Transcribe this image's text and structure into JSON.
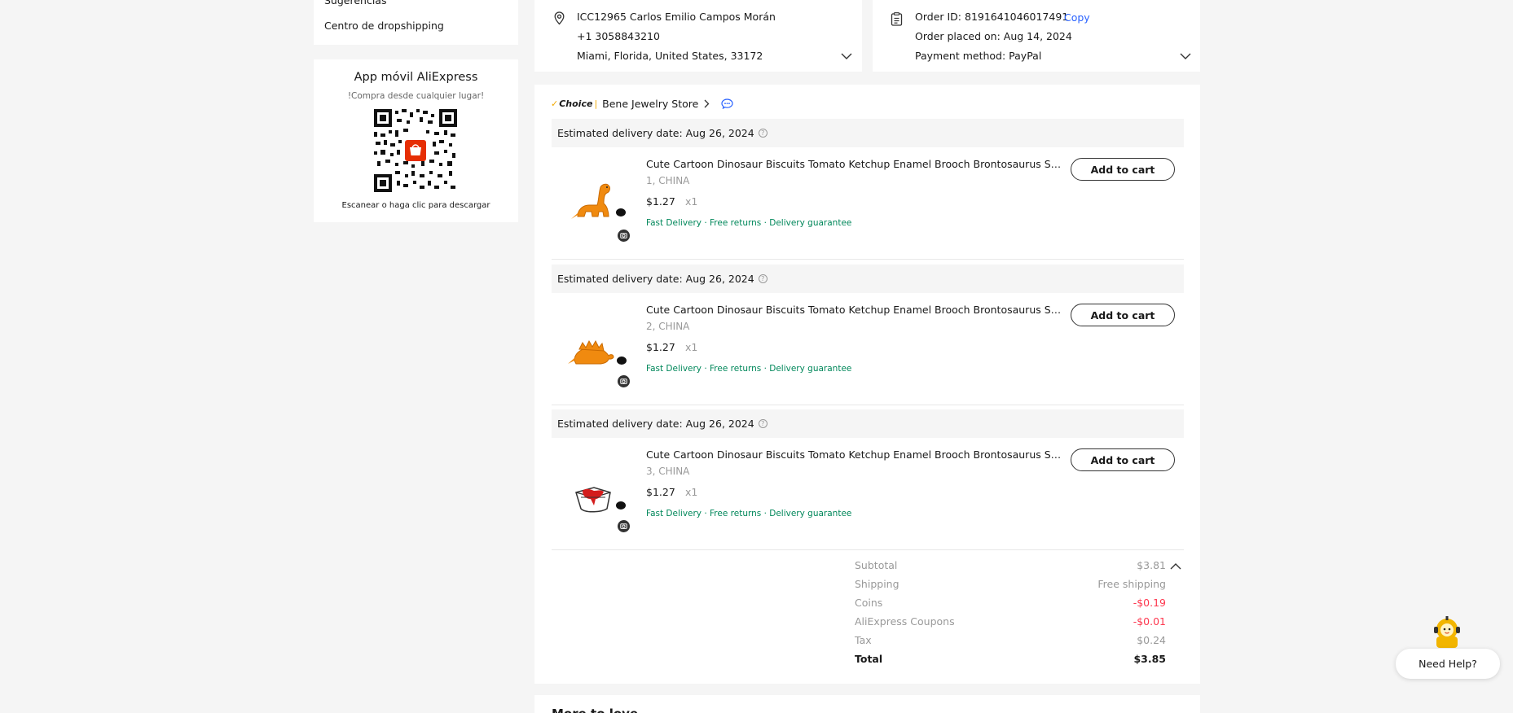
{
  "sidebar": {
    "link_partial": "Sugerencias",
    "link_dropshipping": "Centro de dropshipping"
  },
  "app_card": {
    "title": "App móvil AliExpress",
    "subtitle": "!Compra desde cualquier lugar!",
    "footer": "Escanear o haga clic para descargar"
  },
  "address": {
    "name": "ICC12965 Carlos Emilio Campos Morán",
    "phone": "+1 3058843210",
    "location": "Miami, Florida, United States, 33172"
  },
  "order_info": {
    "order_id": "Order ID: 8191641046017491",
    "copy_label": "Copy",
    "placed_on": "Order placed on: Aug 14, 2024",
    "payment": "Payment method: PayPal"
  },
  "store": {
    "choice_label": "Choice",
    "name": "Bene Jewelry Store"
  },
  "items": [
    {
      "delivery": "Estimated delivery date: Aug 26, 2024",
      "title": "Cute Cartoon Dinosaur Biscuits Tomato Ketchup Enamel Brooch Brontosaurus Stegosaurus Pin Jewelry Gift",
      "variant": "1, CHINA",
      "price": "$1.27",
      "qty": "x1",
      "tags": "Fast Delivery · Free returns · Delivery guarantee",
      "cart_label": "Add to cart"
    },
    {
      "delivery": "Estimated delivery date: Aug 26, 2024",
      "title": "Cute Cartoon Dinosaur Biscuits Tomato Ketchup Enamel Brooch Brontosaurus Stegosaurus Pin Jewelry Gift",
      "variant": "2, CHINA",
      "price": "$1.27",
      "qty": "x1",
      "tags": "Fast Delivery · Free returns · Delivery guarantee",
      "cart_label": "Add to cart"
    },
    {
      "delivery": "Estimated delivery date: Aug 26, 2024",
      "title": "Cute Cartoon Dinosaur Biscuits Tomato Ketchup Enamel Brooch Brontosaurus Stegosaurus Pin Jewelry Gift",
      "variant": "3, CHINA",
      "price": "$1.27",
      "qty": "x1",
      "tags": "Fast Delivery · Free returns · Delivery guarantee",
      "cart_label": "Add to cart"
    }
  ],
  "summary": {
    "subtotal_label": "Subtotal",
    "subtotal": "$3.81",
    "shipping_label": "Shipping",
    "shipping": "Free shipping",
    "coins_label": "Coins",
    "coins": "-$0.19",
    "coupons_label": "AliExpress Coupons",
    "coupons": "-$0.01",
    "tax_label": "Tax",
    "tax": "$0.24",
    "total_label": "Total",
    "total": "$3.85"
  },
  "more_to_love": "More to love",
  "help": {
    "label": "Need Help?"
  },
  "colors": {
    "accent_link": "#2962ff",
    "discount_red": "#fd384f",
    "guarantee_green": "#00875a",
    "choice_yellow": "#f2a900"
  },
  "icons": [
    "location-pin-icon",
    "order-document-icon",
    "chevron-down-icon",
    "chevron-right-icon",
    "chat-icon",
    "question-icon",
    "camera-icon",
    "chevron-up-icon"
  ]
}
